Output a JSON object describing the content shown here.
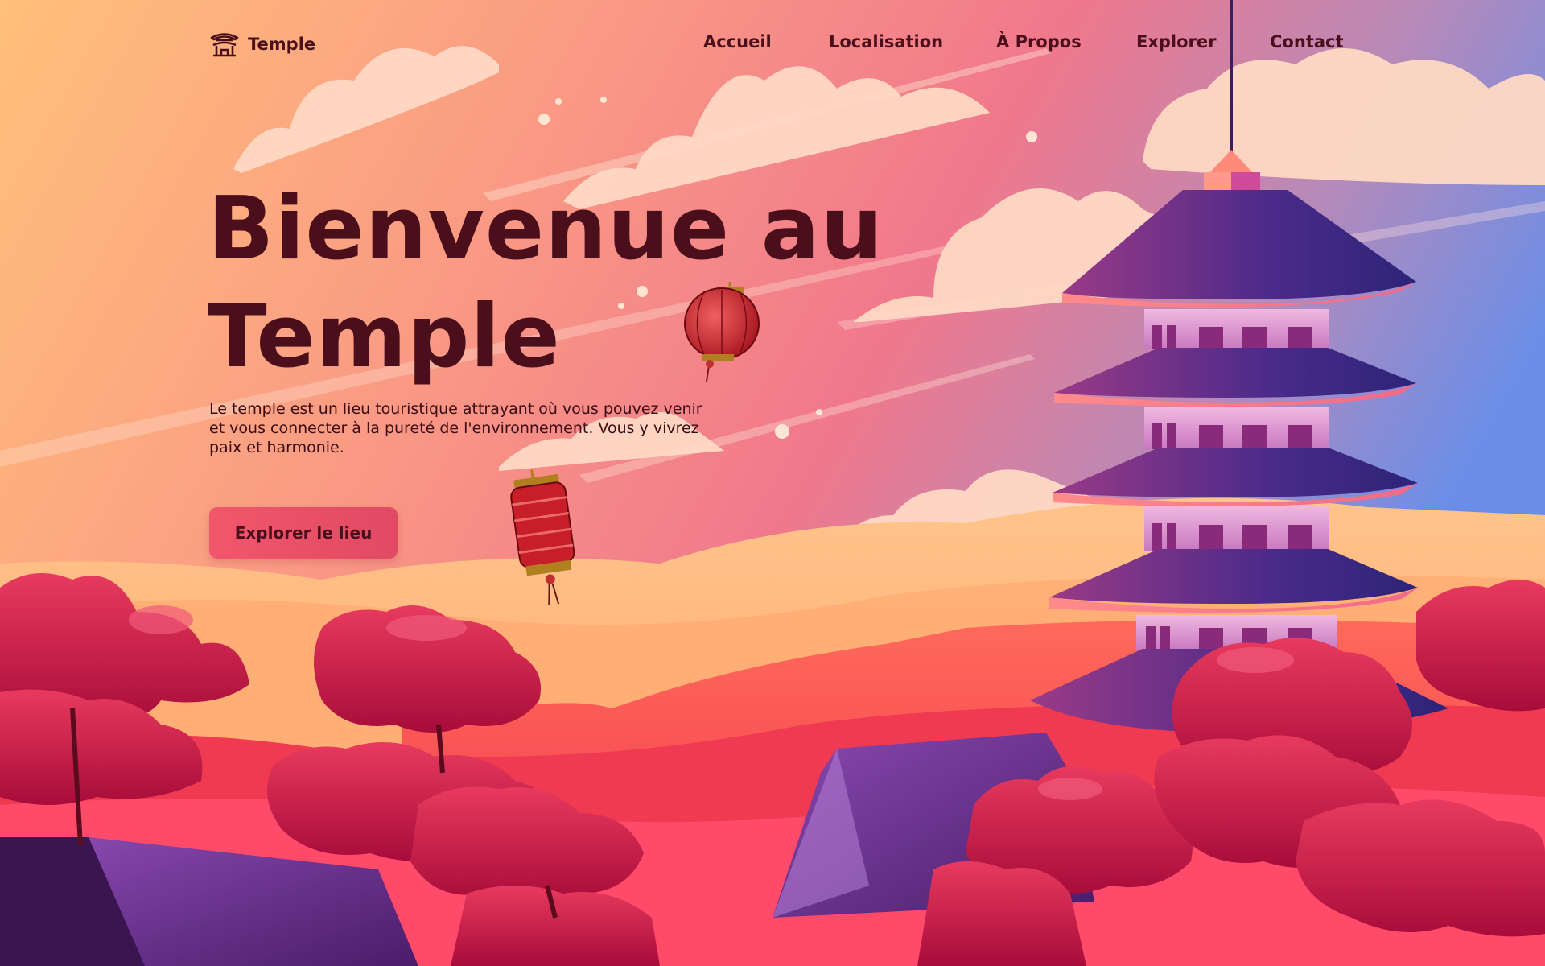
{
  "brand": {
    "name": "Temple",
    "icon": "temple-icon"
  },
  "nav": {
    "items": [
      {
        "label": "Accueil"
      },
      {
        "label": "Localisation"
      },
      {
        "label": "À Propos"
      },
      {
        "label": "Explorer"
      },
      {
        "label": "Contact"
      }
    ]
  },
  "hero": {
    "title": "Bienvenue au Temple",
    "description": "Le temple est un lieu touristique attrayant où vous pouvez venir et vous connecter à la pureté de l'environnement. Vous y vivrez paix et harmonie.",
    "cta_label": "Explorer le lieu"
  },
  "colors": {
    "text_dark": "#4a0f1a",
    "cta": "#f2566c",
    "sky_left": "#ffb877",
    "sky_mid": "#f77b86",
    "sky_right": "#6e8ee6",
    "pagoda_roof": "#3a2680",
    "foliage": "#c4123f"
  }
}
